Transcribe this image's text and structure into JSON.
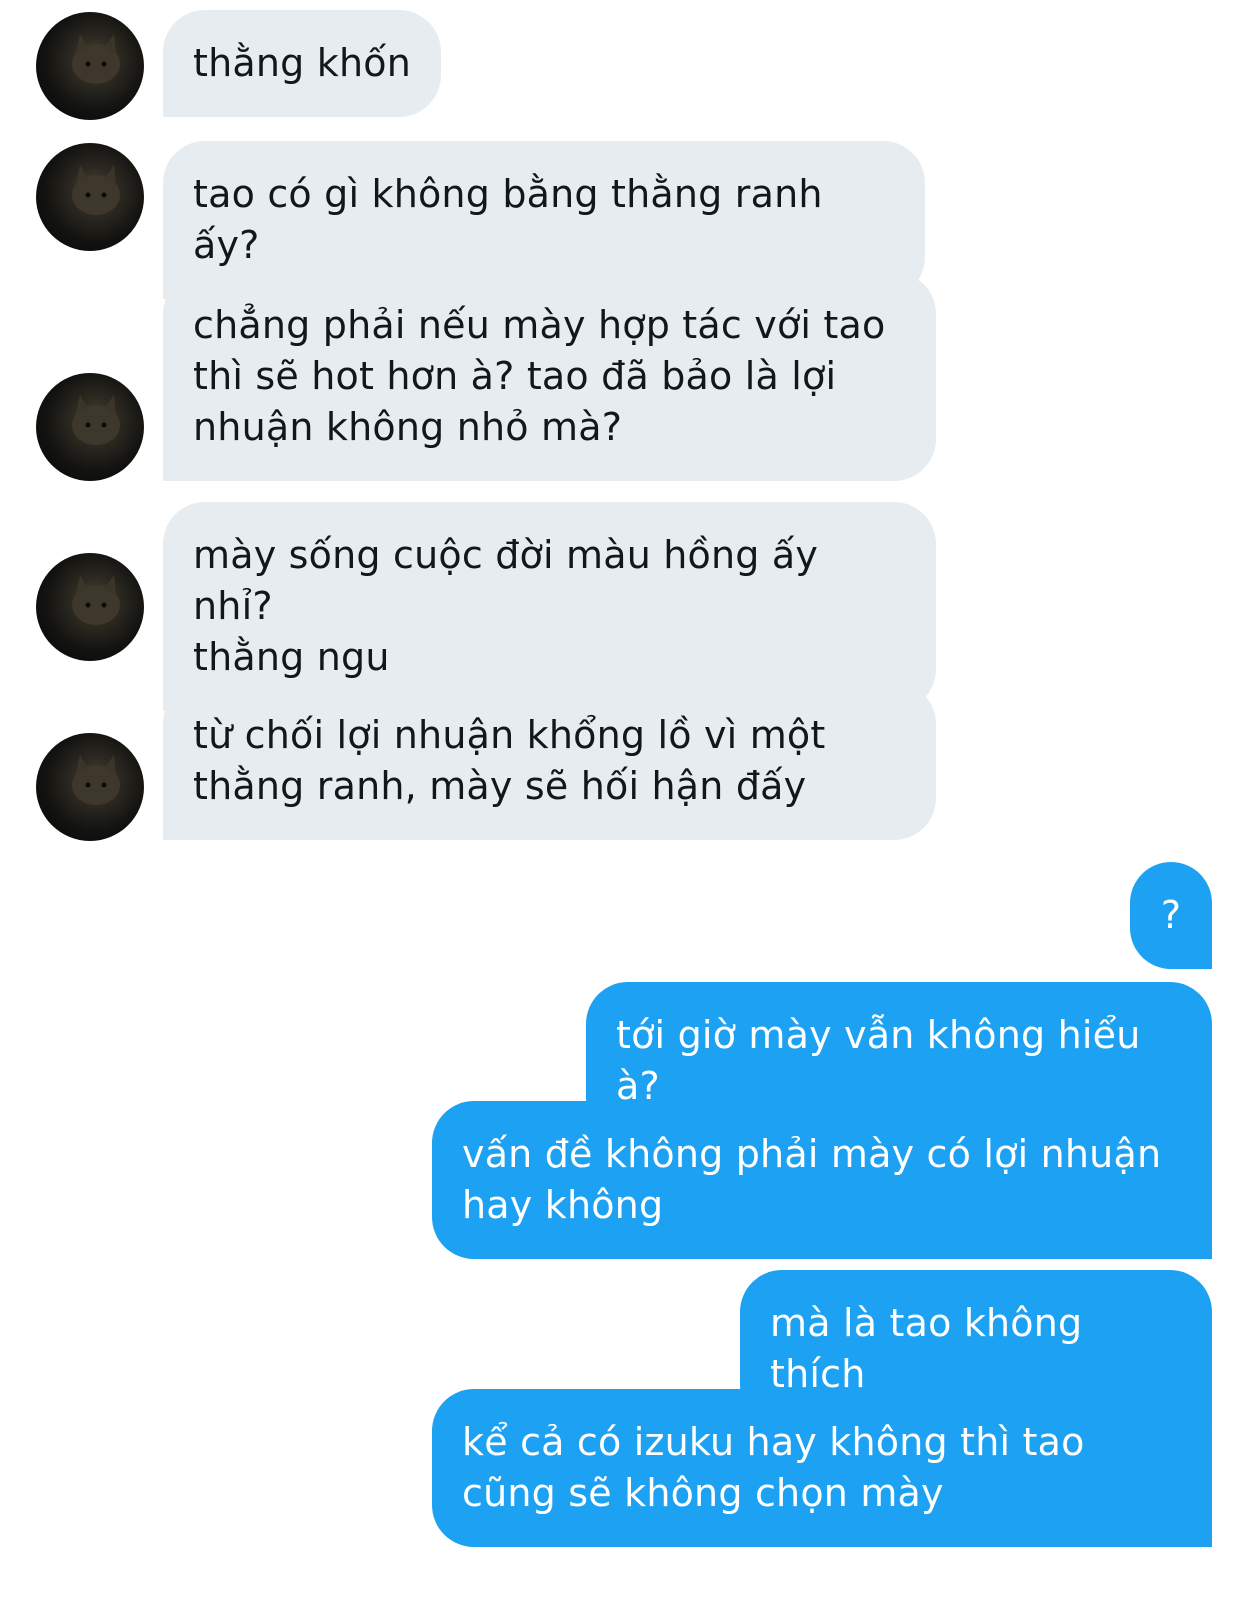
{
  "conversation": {
    "incoming": [
      {
        "text": "thằng khốn",
        "avatar": "cat-avatar"
      },
      {
        "text": "tao có gì không bằng thằng ranh ấy?",
        "avatar": "cat-avatar"
      },
      {
        "text": "chẳng phải nếu mày hợp tác với tao\nthì sẽ hot hơn à? tao đã bảo là lợi\nnhuận không nhỏ mà?",
        "avatar": "cat-avatar"
      },
      {
        "text": "mày sống cuộc đời màu hồng ấy nhỉ?\nthằng ngu",
        "avatar": "cat-avatar"
      },
      {
        "text": "từ chối lợi nhuận khổng lồ vì một\nthằng ranh, mày sẽ hối hận đấy",
        "avatar": "cat-avatar"
      }
    ],
    "outgoing": [
      {
        "text": "?"
      },
      {
        "text": "tới giờ mày vẫn không hiểu à?"
      },
      {
        "text": "vấn đề không phải mày có lợi nhuận\nhay không"
      },
      {
        "text": "mà là tao không thích"
      },
      {
        "text": "kể cả có izuku hay không thì tao\ncũng sẽ không chọn mày"
      }
    ]
  },
  "colors": {
    "incoming_bubble": "#e6ecf0",
    "incoming_text": "#14171a",
    "outgoing_bubble": "#1da1f2",
    "outgoing_text": "#ffffff"
  }
}
